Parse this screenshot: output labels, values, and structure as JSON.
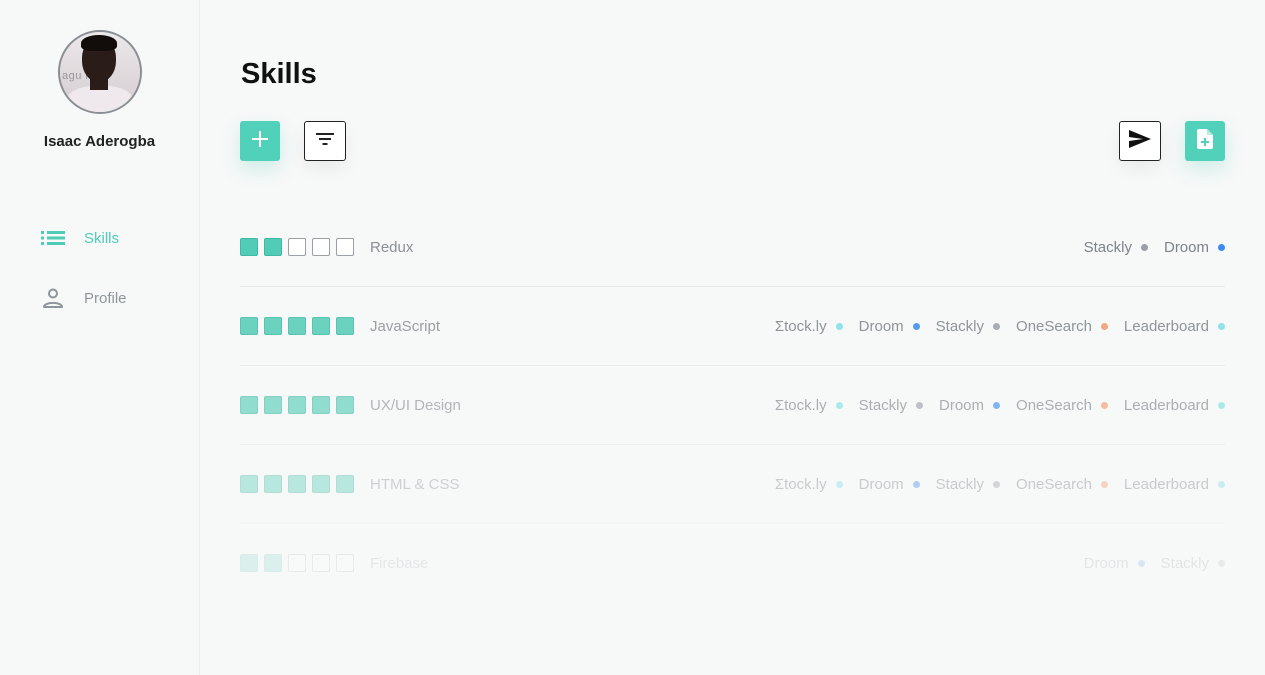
{
  "user": {
    "name": "Isaac Aderogba",
    "avatar_text": "agu n"
  },
  "nav": [
    {
      "label": "Skills",
      "icon": "list-icon",
      "active": true
    },
    {
      "label": "Profile",
      "icon": "person-icon",
      "active": false
    }
  ],
  "page": {
    "title": "Skills"
  },
  "toolbar": {
    "add_icon": "plus-icon",
    "filter_icon": "filter-icon",
    "send_icon": "send-icon",
    "doc_icon": "note-add-icon"
  },
  "colors": {
    "accent": "#52d1ba",
    "dot_gray": "#9aa0a6",
    "dot_blue": "#3b8bf0",
    "dot_cyan": "#7fe0e6",
    "dot_orange": "#f39a6e"
  },
  "skills": [
    {
      "name": "Redux",
      "level": 2,
      "opacity": 1.0,
      "projects": [
        {
          "name": "Stackly",
          "color": "#9aa0a6"
        },
        {
          "name": "Droom",
          "color": "#3b8bf0"
        }
      ]
    },
    {
      "name": "JavaScript",
      "level": 5,
      "opacity": 0.85,
      "projects": [
        {
          "name": "Σtock.ly",
          "color": "#7fe0e6"
        },
        {
          "name": "Droom",
          "color": "#3b8bf0"
        },
        {
          "name": "Stackly",
          "color": "#9aa0a6"
        },
        {
          "name": "OneSearch",
          "color": "#f39a6e"
        },
        {
          "name": "Leaderboard",
          "color": "#7fe0e6"
        }
      ]
    },
    {
      "name": "UX/UI Design",
      "level": 5,
      "opacity": 0.62,
      "projects": [
        {
          "name": "Σtock.ly",
          "color": "#7fe0e6"
        },
        {
          "name": "Stackly",
          "color": "#9aa0a6"
        },
        {
          "name": "Droom",
          "color": "#3b8bf0"
        },
        {
          "name": "OneSearch",
          "color": "#f39a6e"
        },
        {
          "name": "Leaderboard",
          "color": "#7fe0e6"
        }
      ]
    },
    {
      "name": "HTML & CSS",
      "level": 5,
      "opacity": 0.38,
      "projects": [
        {
          "name": "Σtock.ly",
          "color": "#7fe0e6"
        },
        {
          "name": "Droom",
          "color": "#3b8bf0"
        },
        {
          "name": "Stackly",
          "color": "#9aa0a6"
        },
        {
          "name": "OneSearch",
          "color": "#f39a6e"
        },
        {
          "name": "Leaderboard",
          "color": "#7fe0e6"
        }
      ]
    },
    {
      "name": "Firebase",
      "level": 2,
      "opacity": 0.16,
      "projects": [
        {
          "name": "Droom",
          "color": "#3b8bf0"
        },
        {
          "name": "Stackly",
          "color": "#9aa0a6"
        }
      ]
    }
  ]
}
